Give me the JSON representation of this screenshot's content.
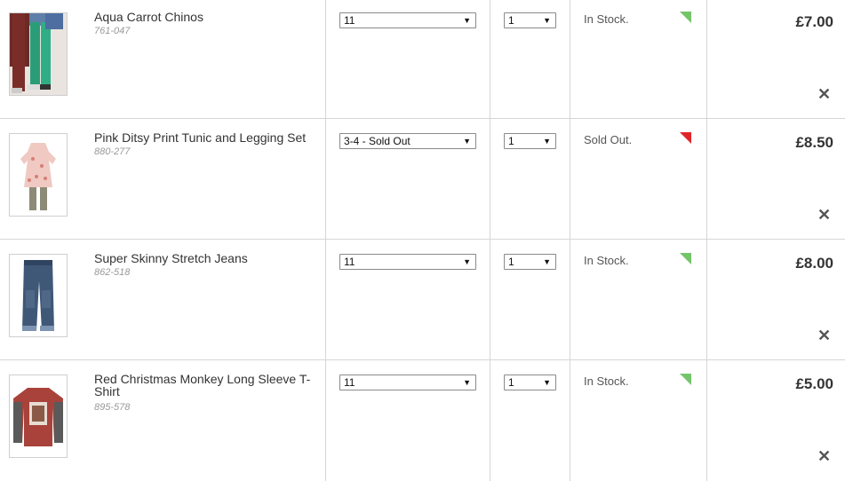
{
  "items": [
    {
      "name": "Aqua Carrot Chinos",
      "code": "761-047",
      "size": "11",
      "qty": "1",
      "stock": "In Stock.",
      "stock_status": "in",
      "price": "£7.00",
      "remove_label": "✕",
      "image_icon": "chinos-image"
    },
    {
      "name": "Pink Ditsy Print Tunic and Legging Set",
      "code": "880-277",
      "size": "3-4 - Sold Out",
      "qty": "1",
      "stock": "Sold Out.",
      "stock_status": "out",
      "price": "£8.50",
      "remove_label": "✕",
      "image_icon": "tunic-image"
    },
    {
      "name": "Super Skinny Stretch Jeans",
      "code": "862-518",
      "size": "11",
      "qty": "1",
      "stock": "In Stock.",
      "stock_status": "in",
      "price": "£8.00",
      "remove_label": "✕",
      "image_icon": "jeans-image"
    },
    {
      "name": "Red Christmas Monkey Long Sleeve T-Shirt",
      "code": "895-578",
      "size": "11",
      "qty": "1",
      "stock": "In Stock.",
      "stock_status": "in",
      "price": "£5.00",
      "remove_label": "✕",
      "image_icon": "tshirt-image"
    }
  ],
  "select_arrow": "▼",
  "colors": {
    "in_stock_flag": "#74c46a",
    "sold_out_flag": "#e0262a",
    "border": "#d6d6d6"
  }
}
